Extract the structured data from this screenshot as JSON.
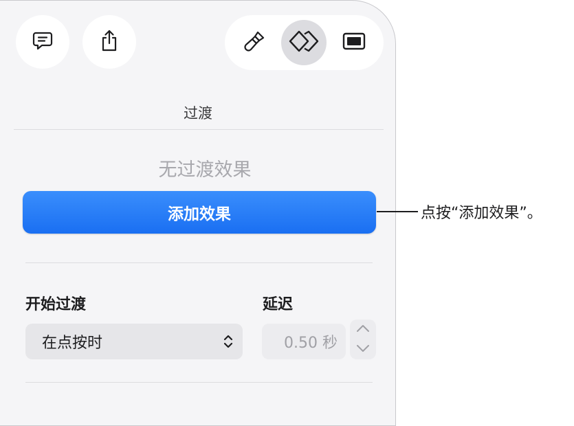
{
  "toolbar": {
    "left_buttons": [
      {
        "icon": "comment-icon"
      },
      {
        "icon": "share-icon"
      }
    ],
    "segments": [
      {
        "icon": "paintbrush-icon",
        "active": false
      },
      {
        "icon": "transition-diamond-icon",
        "active": true
      },
      {
        "icon": "slide-icon",
        "active": false
      }
    ]
  },
  "inspector": {
    "tab_title": "过渡",
    "empty_state": "无过渡效果",
    "add_button_label": "添加效果",
    "start_transition": {
      "label": "开始过渡",
      "selected": "在点按时"
    },
    "delay": {
      "label": "延迟",
      "value": "0.50 秒"
    }
  },
  "callout": {
    "text": "点按“添加效果”。"
  },
  "colors": {
    "accent": "#1a6ff2",
    "panel_bg": "#f5f5f7",
    "active_segment": "#dcdce0"
  }
}
